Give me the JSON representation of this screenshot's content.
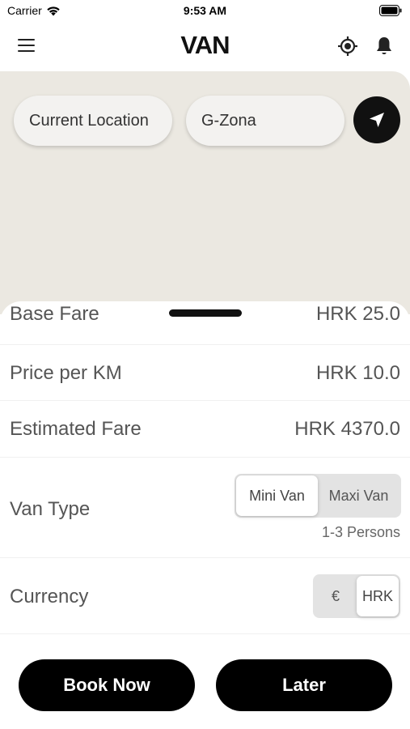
{
  "status_bar": {
    "carrier": "Carrier",
    "time": "9:53 AM"
  },
  "header": {
    "brand": "VAN",
    "icons": [
      "menu-icon",
      "my-location-icon",
      "bell-icon"
    ]
  },
  "map": {
    "origin": "Current Location",
    "destination": "G-Zona",
    "background_color": "#ebe8e1"
  },
  "fare": {
    "base_fare_label": "Base Fare",
    "base_fare_value": "HRK 25.0",
    "price_per_km_label": "Price per KM",
    "price_per_km_value": "HRK 10.0",
    "estimated_label": "Estimated Fare",
    "estimated_value": "HRK 4370.0"
  },
  "van_type": {
    "label": "Van Type",
    "options": [
      "Mini Van",
      "Maxi Van"
    ],
    "selected": "Mini Van",
    "hint": "1-3 Persons"
  },
  "currency": {
    "label": "Currency",
    "options": [
      "€",
      "HRK"
    ],
    "selected": "HRK"
  },
  "actions": {
    "book_now": "Book Now",
    "later": "Later"
  },
  "colors": {
    "primary": "#000000",
    "text": "#555555",
    "segment_bg": "#e3e3e3"
  }
}
